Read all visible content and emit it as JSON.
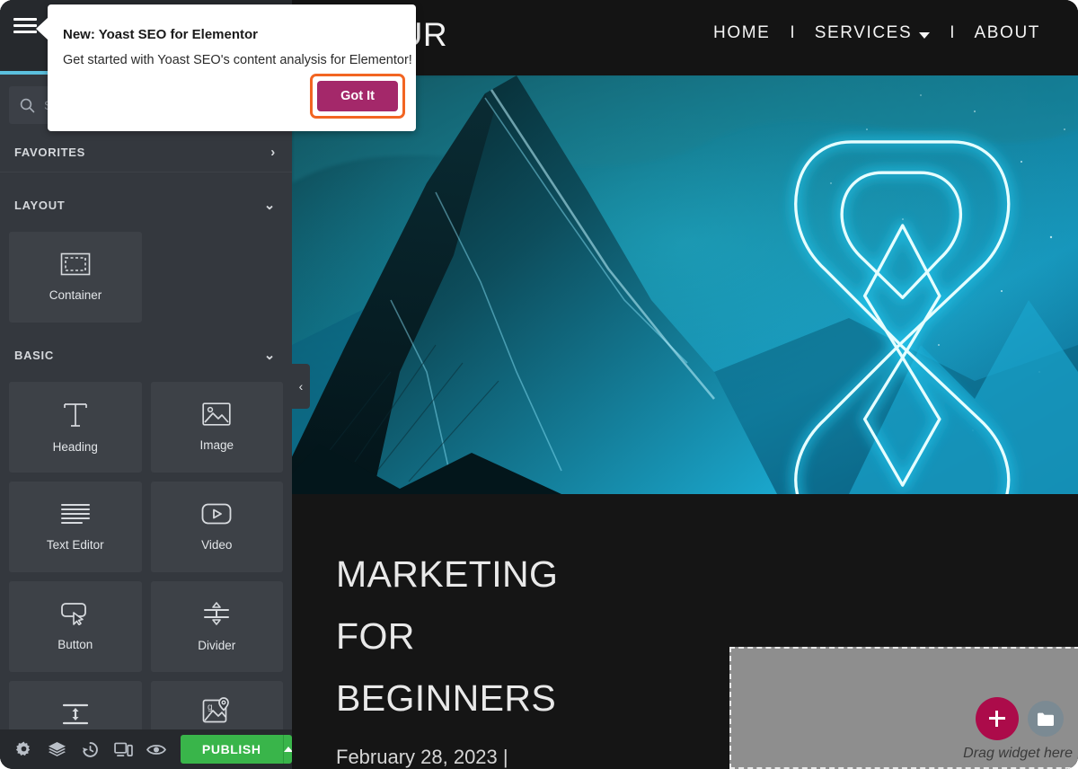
{
  "site": {
    "logo": "EHOUR",
    "nav": [
      {
        "label": "HOME",
        "has_dropdown": false
      },
      {
        "label": "SERVICES",
        "has_dropdown": true
      },
      {
        "label": "ABOUT",
        "has_dropdown": false
      }
    ],
    "nav_separator": "I",
    "hero": {
      "image_alt": "neon-teal-abstract-glyph-over-icy-mountain",
      "headline_lines": [
        "MARKETING",
        "FOR",
        "BEGINNERS"
      ],
      "date": "February 28, 2023 |"
    },
    "drop_area": {
      "label": "Drag widget here",
      "add_icon": "plus-icon",
      "folder_icon": "folder-icon"
    }
  },
  "panel": {
    "menu_icon": "hamburger-menu-icon",
    "accent_color": "#5bc0de",
    "search": {
      "icon": "search-icon",
      "value": "",
      "placeholder": "Search Widget..."
    },
    "sections": [
      {
        "key": "favorites",
        "title": "FAVORITES",
        "chevron": "chevron-right-icon",
        "expanded": false
      },
      {
        "key": "layout",
        "title": "LAYOUT",
        "chevron": "chevron-down-icon",
        "expanded": true
      },
      {
        "key": "basic",
        "title": "BASIC",
        "chevron": "chevron-down-icon",
        "expanded": true
      }
    ],
    "layout_widgets": [
      {
        "label": "Container",
        "icon": "container-icon"
      }
    ],
    "basic_widgets": [
      {
        "label": "Heading",
        "icon": "heading-icon"
      },
      {
        "label": "Image",
        "icon": "image-icon"
      },
      {
        "label": "Text Editor",
        "icon": "text-editor-icon"
      },
      {
        "label": "Video",
        "icon": "video-icon"
      },
      {
        "label": "Button",
        "icon": "button-icon"
      },
      {
        "label": "Divider",
        "icon": "divider-icon"
      },
      {
        "label": "",
        "icon": "spacer-icon"
      },
      {
        "label": "",
        "icon": "google-maps-icon"
      }
    ],
    "collapse_handle": "chevron-left-icon",
    "footer": {
      "tools": [
        {
          "name": "settings",
          "icon": "gear-icon"
        },
        {
          "name": "navigator",
          "icon": "layers-icon"
        },
        {
          "name": "history",
          "icon": "history-icon"
        },
        {
          "name": "responsive",
          "icon": "responsive-mode-icon"
        },
        {
          "name": "preview",
          "icon": "eye-icon"
        }
      ],
      "publish_label": "PUBLISH",
      "publish_color": "#39b54a",
      "publish_caret": "caret-up-icon"
    }
  },
  "popup": {
    "title": "New: Yoast SEO for Elementor",
    "body": "Get started with Yoast SEO's content analysis for Elementor!",
    "cta_label": "Got It",
    "cta_color": "#a4286a",
    "highlight_color": "#f26522"
  }
}
